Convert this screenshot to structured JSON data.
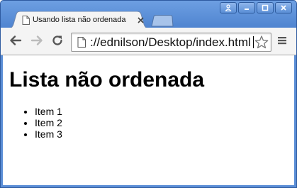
{
  "window": {
    "controls": [
      "user-icon",
      "minimize-icon",
      "maximize-icon",
      "close-icon"
    ]
  },
  "tabs": [
    {
      "title": "Usando lista não ordenada",
      "active": true
    }
  ],
  "toolbar": {
    "address": "://ednilson/Desktop/index.html",
    "icons": [
      "back-arrow-icon",
      "forward-arrow-icon",
      "reload-icon",
      "page-icon",
      "bookmark-star-icon",
      "menu-icon"
    ]
  },
  "page": {
    "heading": "Lista não ordenada",
    "items": [
      "Item 1",
      "Item 2",
      "Item 3"
    ]
  },
  "colors": {
    "frame": "#5b8ed6",
    "toolbar": "#f4f4f4",
    "content": "#ffffff"
  }
}
